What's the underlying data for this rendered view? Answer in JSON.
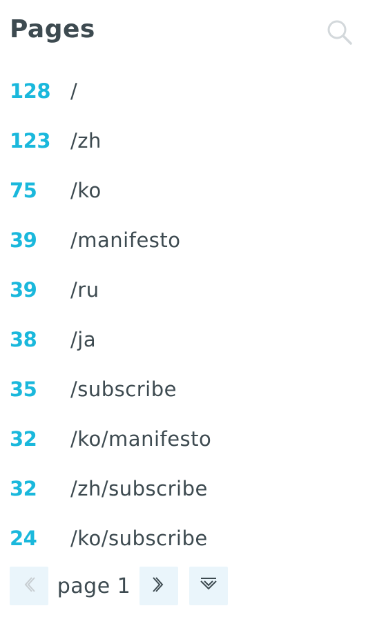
{
  "header": {
    "title": "Pages"
  },
  "icons": {
    "search": "search-icon",
    "prev": "chevron-left-icon",
    "next": "chevron-right-icon",
    "expand": "expand-down-icon"
  },
  "colors": {
    "count": "#1ab8dc",
    "text": "#3d4a50",
    "button_bg": "#eaf5fb",
    "icon": "#c7cdd1"
  },
  "rows": [
    {
      "count": "128",
      "path": "/"
    },
    {
      "count": "123",
      "path": "/zh"
    },
    {
      "count": "75",
      "path": "/ko"
    },
    {
      "count": "39",
      "path": "/manifesto"
    },
    {
      "count": "39",
      "path": "/ru"
    },
    {
      "count": "38",
      "path": "/ja"
    },
    {
      "count": "35",
      "path": "/subscribe"
    },
    {
      "count": "32",
      "path": "/ko/manifesto"
    },
    {
      "count": "32",
      "path": "/zh/subscribe"
    },
    {
      "count": "24",
      "path": "/ko/subscribe"
    }
  ],
  "pagination": {
    "label": "page 1"
  }
}
